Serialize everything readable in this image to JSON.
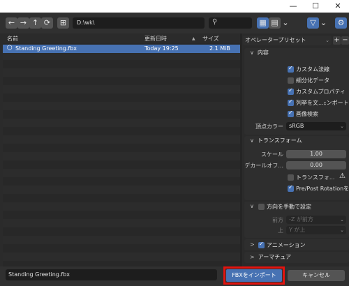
{
  "titlebar": {
    "minimize": "—",
    "maximize": "☐",
    "close": "✕"
  },
  "header": {
    "back_icon": "←",
    "forward_icon": "→",
    "parent_icon": "↑",
    "refresh_icon": "⟳",
    "new_folder_icon": "⊞",
    "path": "D:\\wk\\",
    "search_icon": "⚲",
    "view_icon": "▦",
    "view2_icon": "▤",
    "sort_icon": "⌄",
    "filter_icon": "▽",
    "gear_icon": "⚙"
  },
  "filelist": {
    "col_name": "名前",
    "col_date": "更新日時",
    "sort_arrow": "▲",
    "col_size": "サイズ",
    "files": [
      {
        "name": "Standing Greeting.fbx",
        "date": "Today 19:25",
        "size": "2.1 MiB"
      }
    ]
  },
  "panel": {
    "preset_label": "オペレータープリセット",
    "plus": "+",
    "minus": "−",
    "include": {
      "title": "内容",
      "options": [
        {
          "label": "カスタム法線",
          "checked": true
        },
        {
          "label": "細分化データ",
          "checked": false
        },
        {
          "label": "カスタムプロパティ",
          "checked": true
        },
        {
          "label": "列挙を文...ｪンポート",
          "checked": true
        },
        {
          "label": "画像検索",
          "checked": true
        }
      ],
      "vertex_color_label": "頂点カラー",
      "vertex_color_value": "sRGB"
    },
    "transform": {
      "title": "トランスフォーム",
      "scale_label": "スケール",
      "scale_value": "1.00",
      "decal_label": "デカールオフ...",
      "decal_value": "0.00",
      "apply_transform_label": "トランスフォ...",
      "prepost_label": "Pre/Post Rotationを...",
      "warning_icon": "⚠"
    },
    "orientation": {
      "title": "方向を手動で設定",
      "forward_label": "前方",
      "forward_value": "-Z が前方",
      "up_label": "上",
      "up_value": "Y が上"
    },
    "animation_title": "アニメーション",
    "armature_title": "アーマチュア"
  },
  "bottom": {
    "filename": "Standing Greeting.fbx",
    "import_label": "FBXをインポート",
    "cancel_label": "キャンセル"
  },
  "colors": {
    "accent": "#4772b3",
    "highlight": "#e3130f"
  }
}
